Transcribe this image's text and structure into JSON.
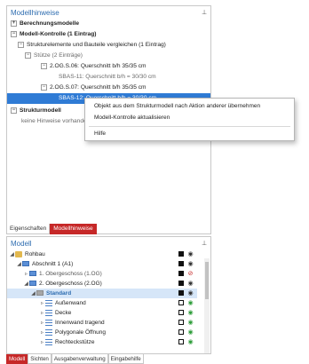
{
  "top_panel": {
    "title": "Modellhinweise",
    "rows": [
      {
        "label": "Berechnungsmodelle"
      },
      {
        "label": "Modell-Kontrolle (1 Eintrag)"
      },
      {
        "label": "Strukturelemente und Bauteile vergleichen (1 Eintrag)"
      },
      {
        "label": "Stütze (2 Einträge)"
      },
      {
        "label": "2.OG.S.06: Querschnitt b/h    35/35 cm"
      },
      {
        "label": "SBAS-11: Querschnitt b/h = 30/30 cm"
      },
      {
        "label": "2.OG.S.07: Querschnitt b/h    35/35 cm"
      },
      {
        "label": "SBAS-12: Querschnitt b/h = 30/30 cm"
      },
      {
        "label": "Strukturmodell"
      },
      {
        "label": "keine Hinweise vorhanden"
      }
    ]
  },
  "context_menu": {
    "items": [
      {
        "label": "Objekt aus dem Strukturmodell nach Aktion anderer übernehmen"
      },
      {
        "label": "Modell-Kontrolle aktualisieren"
      },
      {
        "label": "Hilfe"
      }
    ]
  },
  "top_tabs": [
    {
      "label": "Eigenschaften"
    },
    {
      "label": "Modellhinweise"
    }
  ],
  "model_panel": {
    "title": "Modell",
    "rows": [
      {
        "label": "Rohbau"
      },
      {
        "label": "Abschnitt 1 (A1)"
      },
      {
        "label": "1. Obergeschoss (1.OG)"
      },
      {
        "label": "2. Obergeschoss (2.OG)"
      },
      {
        "label": "Standard"
      },
      {
        "label": "Außenwand"
      },
      {
        "label": "Decke"
      },
      {
        "label": "Innenwand tragend"
      },
      {
        "label": "Polygonale Öffnung"
      },
      {
        "label": "Rechteckstütze"
      }
    ]
  },
  "bottom_tabs": [
    {
      "label": "Modell"
    },
    {
      "label": "Sichten"
    },
    {
      "label": "Ausgabenverwaltung"
    },
    {
      "label": "Eingabehilfe"
    }
  ],
  "icons": {
    "pin": "pin-icon",
    "expand": "expand-toggle-icon",
    "eye": "eye-icon"
  },
  "colors": {
    "accent_blue": "#2e6db0",
    "selection": "#2f7bd5",
    "active_tab_red": "#c62828",
    "visible_green": "#2e9d3a"
  }
}
